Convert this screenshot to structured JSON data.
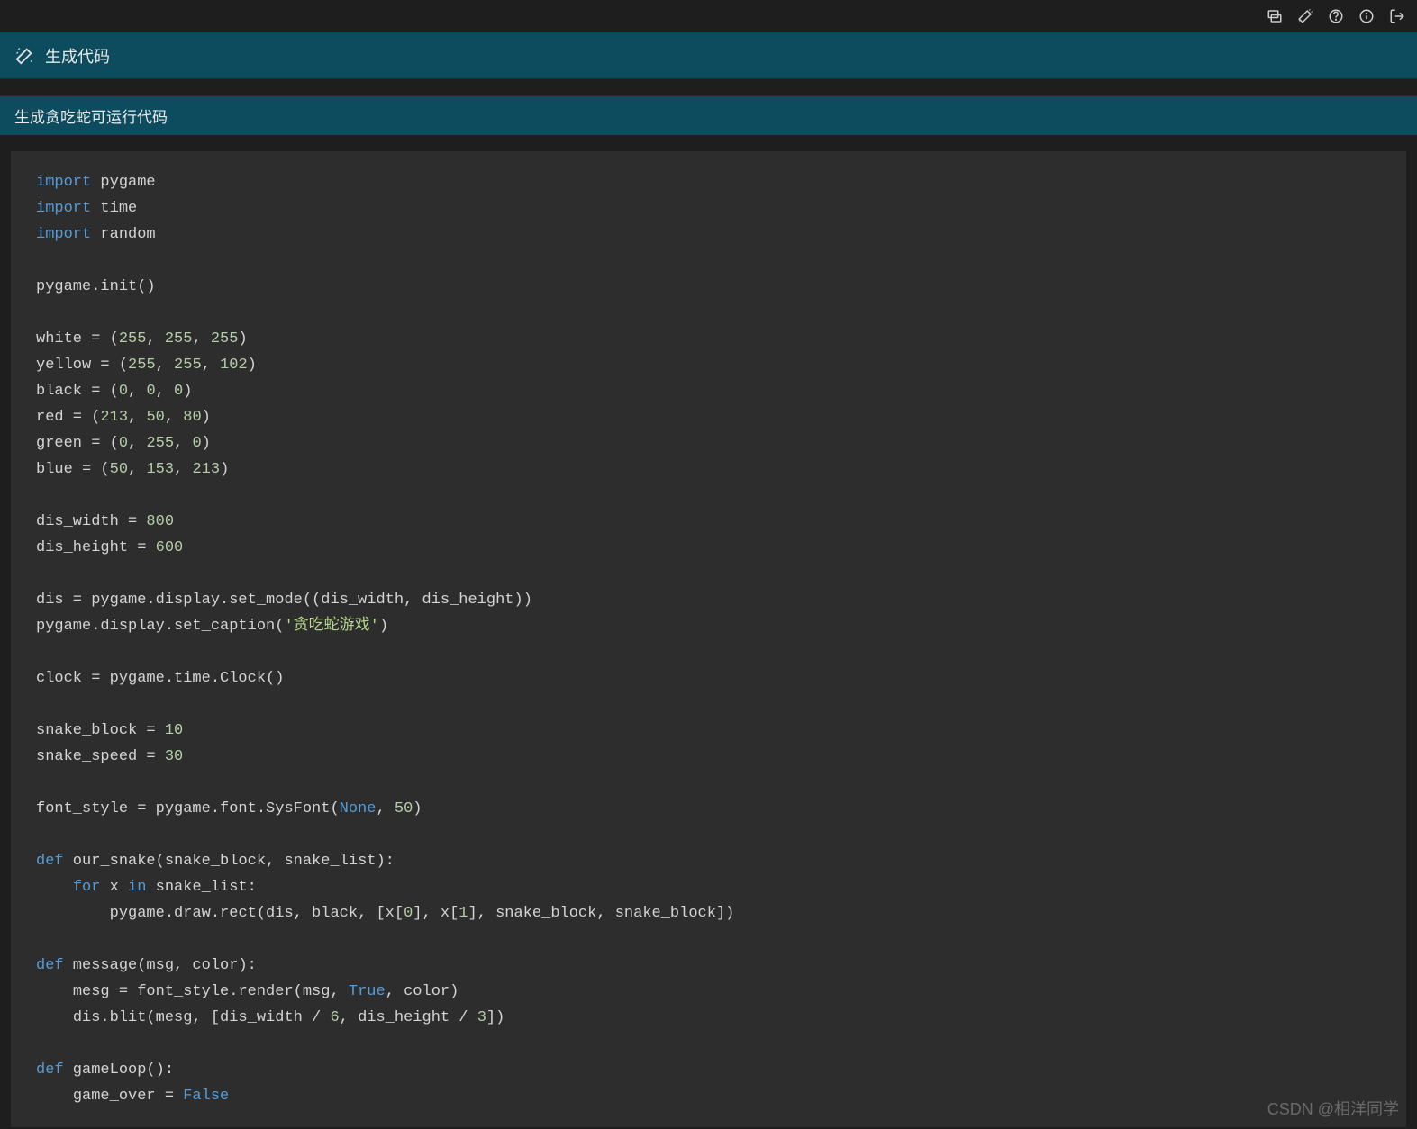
{
  "header": {
    "title": "生成代码"
  },
  "subheader": {
    "subtitle": "生成贪吃蛇可运行代码"
  },
  "watermark": "CSDN @相洋同学",
  "code": {
    "lines": [
      {
        "type": "import",
        "kw": "import",
        "rest": " pygame"
      },
      {
        "type": "import",
        "kw": "import",
        "rest": " time"
      },
      {
        "type": "import",
        "kw": "import",
        "rest": " random"
      },
      {
        "type": "blank"
      },
      {
        "type": "plain",
        "text": "pygame.init()"
      },
      {
        "type": "blank"
      },
      {
        "type": "tuple3",
        "prefix": "white = (",
        "a": "255",
        "b": "255",
        "c": "255",
        "suffix": ")"
      },
      {
        "type": "tuple3",
        "prefix": "yellow = (",
        "a": "255",
        "b": "255",
        "c": "102",
        "suffix": ")"
      },
      {
        "type": "tuple3",
        "prefix": "black = (",
        "a": "0",
        "b": "0",
        "c": "0",
        "suffix": ")"
      },
      {
        "type": "tuple3",
        "prefix": "red = (",
        "a": "213",
        "b": "50",
        "c": "80",
        "suffix": ")"
      },
      {
        "type": "tuple3",
        "prefix": "green = (",
        "a": "0",
        "b": "255",
        "c": "0",
        "suffix": ")"
      },
      {
        "type": "tuple3",
        "prefix": "blue = (",
        "a": "50",
        "b": "153",
        "c": "213",
        "suffix": ")"
      },
      {
        "type": "blank"
      },
      {
        "type": "assign_num",
        "prefix": "dis_width = ",
        "num": "800"
      },
      {
        "type": "assign_num",
        "prefix": "dis_height = ",
        "num": "600"
      },
      {
        "type": "blank"
      },
      {
        "type": "plain",
        "text": "dis = pygame.display.set_mode((dis_width, dis_height))"
      },
      {
        "type": "caption",
        "prefix": "pygame.display.set_caption(",
        "str": "'贪吃蛇游戏'",
        "suffix": ")"
      },
      {
        "type": "blank"
      },
      {
        "type": "plain",
        "text": "clock = pygame.time.Clock()"
      },
      {
        "type": "blank"
      },
      {
        "type": "assign_num",
        "prefix": "snake_block = ",
        "num": "10"
      },
      {
        "type": "assign_num",
        "prefix": "snake_speed = ",
        "num": "30"
      },
      {
        "type": "blank"
      },
      {
        "type": "sysfont",
        "prefix": "font_style = pygame.font.SysFont(",
        "const": "None",
        "mid": ", ",
        "num": "50",
        "suffix": ")"
      },
      {
        "type": "blank"
      },
      {
        "type": "def",
        "kw": "def",
        "rest": " our_snake(snake_block, snake_list):"
      },
      {
        "type": "forin",
        "indent": "    ",
        "kw1": "for",
        "mid1": " x ",
        "kw2": "in",
        "rest": " snake_list:"
      },
      {
        "type": "indexed2",
        "indent": "        ",
        "prefix": "pygame.draw.rect(dis, black, [x[",
        "a": "0",
        "mid": "], x[",
        "b": "1",
        "suffix": "], snake_block, snake_block])"
      },
      {
        "type": "blank"
      },
      {
        "type": "def",
        "kw": "def",
        "rest": " message(msg, color):"
      },
      {
        "type": "render",
        "indent": "    ",
        "prefix": "mesg = font_style.render(msg, ",
        "const": "True",
        "suffix": ", color)"
      },
      {
        "type": "indexed2",
        "indent": "    ",
        "prefix": "dis.blit(mesg, [dis_width / ",
        "a": "6",
        "mid": ", dis_height / ",
        "b": "3",
        "suffix": "])"
      },
      {
        "type": "blank"
      },
      {
        "type": "def",
        "kw": "def",
        "rest": " gameLoop():"
      },
      {
        "type": "render",
        "indent": "    ",
        "prefix": "game_over = ",
        "const": "False",
        "suffix": ""
      }
    ]
  }
}
